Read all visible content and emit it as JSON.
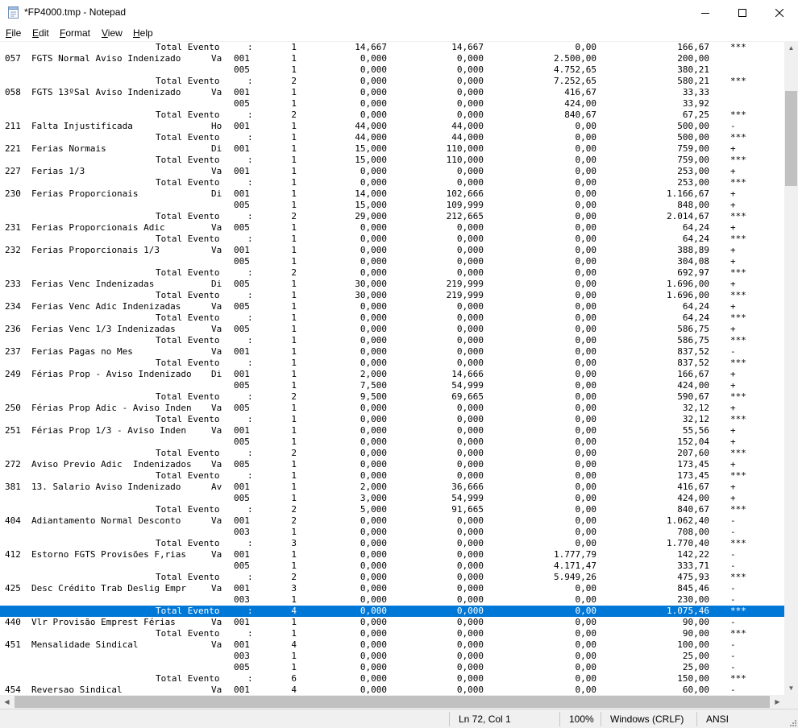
{
  "window": {
    "title": "*FP4000.tmp - Notepad"
  },
  "menu": [
    {
      "label": "File",
      "key": "F",
      "rest": "ile"
    },
    {
      "label": "Edit",
      "key": "E",
      "rest": "dit"
    },
    {
      "label": "Format",
      "key": "F",
      "rest": "ormat"
    },
    {
      "label": "View",
      "key": "V",
      "rest": "iew"
    },
    {
      "label": "Help",
      "key": "H",
      "rest": "elp"
    }
  ],
  "editor": {
    "lines": [
      {
        "code": "",
        "desc": "",
        "tipo": "",
        "ref": "",
        "qt": "1",
        "v1": "14,667",
        "v2": "14,667",
        "v3": "0,00",
        "v4": "166,67",
        "flag": "***",
        "tot": true
      },
      {
        "code": "057",
        "desc": "FGTS Normal Aviso Indenizado",
        "tipo": "Va",
        "ref": "001",
        "qt": "1",
        "v1": "0,000",
        "v2": "0,000",
        "v3": "2.500,00",
        "v4": "200,00",
        "flag": ""
      },
      {
        "code": "",
        "desc": "",
        "tipo": "",
        "ref": "005",
        "qt": "1",
        "v1": "0,000",
        "v2": "0,000",
        "v3": "4.752,65",
        "v4": "380,21",
        "flag": ""
      },
      {
        "code": "",
        "desc": "",
        "tipo": "",
        "ref": "",
        "qt": "2",
        "v1": "0,000",
        "v2": "0,000",
        "v3": "7.252,65",
        "v4": "580,21",
        "flag": "***",
        "tot": true
      },
      {
        "code": "058",
        "desc": "FGTS 13ºSal Aviso Indenizado",
        "tipo": "Va",
        "ref": "001",
        "qt": "1",
        "v1": "0,000",
        "v2": "0,000",
        "v3": "416,67",
        "v4": "33,33",
        "flag": ""
      },
      {
        "code": "",
        "desc": "",
        "tipo": "",
        "ref": "005",
        "qt": "1",
        "v1": "0,000",
        "v2": "0,000",
        "v3": "424,00",
        "v4": "33,92",
        "flag": ""
      },
      {
        "code": "",
        "desc": "",
        "tipo": "",
        "ref": "",
        "qt": "2",
        "v1": "0,000",
        "v2": "0,000",
        "v3": "840,67",
        "v4": "67,25",
        "flag": "***",
        "tot": true
      },
      {
        "code": "211",
        "desc": "Falta Injustificada",
        "tipo": "Ho",
        "ref": "001",
        "qt": "1",
        "v1": "44,000",
        "v2": "44,000",
        "v3": "0,00",
        "v4": "500,00",
        "flag": "-"
      },
      {
        "code": "",
        "desc": "",
        "tipo": "",
        "ref": "",
        "qt": "1",
        "v1": "44,000",
        "v2": "44,000",
        "v3": "0,00",
        "v4": "500,00",
        "flag": "***",
        "tot": true
      },
      {
        "code": "221",
        "desc": "Ferias Normais",
        "tipo": "Di",
        "ref": "001",
        "qt": "1",
        "v1": "15,000",
        "v2": "110,000",
        "v3": "0,00",
        "v4": "759,00",
        "flag": "+"
      },
      {
        "code": "",
        "desc": "",
        "tipo": "",
        "ref": "",
        "qt": "1",
        "v1": "15,000",
        "v2": "110,000",
        "v3": "0,00",
        "v4": "759,00",
        "flag": "***",
        "tot": true
      },
      {
        "code": "227",
        "desc": "Ferias 1/3",
        "tipo": "Va",
        "ref": "001",
        "qt": "1",
        "v1": "0,000",
        "v2": "0,000",
        "v3": "0,00",
        "v4": "253,00",
        "flag": "+"
      },
      {
        "code": "",
        "desc": "",
        "tipo": "",
        "ref": "",
        "qt": "1",
        "v1": "0,000",
        "v2": "0,000",
        "v3": "0,00",
        "v4": "253,00",
        "flag": "***",
        "tot": true
      },
      {
        "code": "230",
        "desc": "Ferias Proporcionais",
        "tipo": "Di",
        "ref": "001",
        "qt": "1",
        "v1": "14,000",
        "v2": "102,666",
        "v3": "0,00",
        "v4": "1.166,67",
        "flag": "+"
      },
      {
        "code": "",
        "desc": "",
        "tipo": "",
        "ref": "005",
        "qt": "1",
        "v1": "15,000",
        "v2": "109,999",
        "v3": "0,00",
        "v4": "848,00",
        "flag": "+"
      },
      {
        "code": "",
        "desc": "",
        "tipo": "",
        "ref": "",
        "qt": "2",
        "v1": "29,000",
        "v2": "212,665",
        "v3": "0,00",
        "v4": "2.014,67",
        "flag": "***",
        "tot": true
      },
      {
        "code": "231",
        "desc": "Ferias Proporcionais Adic",
        "tipo": "Va",
        "ref": "005",
        "qt": "1",
        "v1": "0,000",
        "v2": "0,000",
        "v3": "0,00",
        "v4": "64,24",
        "flag": "+"
      },
      {
        "code": "",
        "desc": "",
        "tipo": "",
        "ref": "",
        "qt": "1",
        "v1": "0,000",
        "v2": "0,000",
        "v3": "0,00",
        "v4": "64,24",
        "flag": "***",
        "tot": true
      },
      {
        "code": "232",
        "desc": "Ferias Proporcionais 1/3",
        "tipo": "Va",
        "ref": "001",
        "qt": "1",
        "v1": "0,000",
        "v2": "0,000",
        "v3": "0,00",
        "v4": "388,89",
        "flag": "+"
      },
      {
        "code": "",
        "desc": "",
        "tipo": "",
        "ref": "005",
        "qt": "1",
        "v1": "0,000",
        "v2": "0,000",
        "v3": "0,00",
        "v4": "304,08",
        "flag": "+"
      },
      {
        "code": "",
        "desc": "",
        "tipo": "",
        "ref": "",
        "qt": "2",
        "v1": "0,000",
        "v2": "0,000",
        "v3": "0,00",
        "v4": "692,97",
        "flag": "***",
        "tot": true
      },
      {
        "code": "233",
        "desc": "Ferias Venc Indenizadas",
        "tipo": "Di",
        "ref": "005",
        "qt": "1",
        "v1": "30,000",
        "v2": "219,999",
        "v3": "0,00",
        "v4": "1.696,00",
        "flag": "+"
      },
      {
        "code": "",
        "desc": "",
        "tipo": "",
        "ref": "",
        "qt": "1",
        "v1": "30,000",
        "v2": "219,999",
        "v3": "0,00",
        "v4": "1.696,00",
        "flag": "***",
        "tot": true
      },
      {
        "code": "234",
        "desc": "Ferias Venc Adic Indenizadas",
        "tipo": "Va",
        "ref": "005",
        "qt": "1",
        "v1": "0,000",
        "v2": "0,000",
        "v3": "0,00",
        "v4": "64,24",
        "flag": "+"
      },
      {
        "code": "",
        "desc": "",
        "tipo": "",
        "ref": "",
        "qt": "1",
        "v1": "0,000",
        "v2": "0,000",
        "v3": "0,00",
        "v4": "64,24",
        "flag": "***",
        "tot": true
      },
      {
        "code": "236",
        "desc": "Ferias Venc 1/3 Indenizadas",
        "tipo": "Va",
        "ref": "005",
        "qt": "1",
        "v1": "0,000",
        "v2": "0,000",
        "v3": "0,00",
        "v4": "586,75",
        "flag": "+"
      },
      {
        "code": "",
        "desc": "",
        "tipo": "",
        "ref": "",
        "qt": "1",
        "v1": "0,000",
        "v2": "0,000",
        "v3": "0,00",
        "v4": "586,75",
        "flag": "***",
        "tot": true
      },
      {
        "code": "237",
        "desc": "Ferias Pagas no Mes",
        "tipo": "Va",
        "ref": "001",
        "qt": "1",
        "v1": "0,000",
        "v2": "0,000",
        "v3": "0,00",
        "v4": "837,52",
        "flag": "-"
      },
      {
        "code": "",
        "desc": "",
        "tipo": "",
        "ref": "",
        "qt": "1",
        "v1": "0,000",
        "v2": "0,000",
        "v3": "0,00",
        "v4": "837,52",
        "flag": "***",
        "tot": true
      },
      {
        "code": "249",
        "desc": "Férias Prop - Aviso Indenizado",
        "tipo": "Di",
        "ref": "001",
        "qt": "1",
        "v1": "2,000",
        "v2": "14,666",
        "v3": "0,00",
        "v4": "166,67",
        "flag": "+"
      },
      {
        "code": "",
        "desc": "",
        "tipo": "",
        "ref": "005",
        "qt": "1",
        "v1": "7,500",
        "v2": "54,999",
        "v3": "0,00",
        "v4": "424,00",
        "flag": "+"
      },
      {
        "code": "",
        "desc": "",
        "tipo": "",
        "ref": "",
        "qt": "2",
        "v1": "9,500",
        "v2": "69,665",
        "v3": "0,00",
        "v4": "590,67",
        "flag": "***",
        "tot": true
      },
      {
        "code": "250",
        "desc": "Férias Prop Adic - Aviso Inden",
        "tipo": "Va",
        "ref": "005",
        "qt": "1",
        "v1": "0,000",
        "v2": "0,000",
        "v3": "0,00",
        "v4": "32,12",
        "flag": "+"
      },
      {
        "code": "",
        "desc": "",
        "tipo": "",
        "ref": "",
        "qt": "1",
        "v1": "0,000",
        "v2": "0,000",
        "v3": "0,00",
        "v4": "32,12",
        "flag": "***",
        "tot": true
      },
      {
        "code": "251",
        "desc": "Férias Prop 1/3 - Aviso Inden",
        "tipo": "Va",
        "ref": "001",
        "qt": "1",
        "v1": "0,000",
        "v2": "0,000",
        "v3": "0,00",
        "v4": "55,56",
        "flag": "+"
      },
      {
        "code": "",
        "desc": "",
        "tipo": "",
        "ref": "005",
        "qt": "1",
        "v1": "0,000",
        "v2": "0,000",
        "v3": "0,00",
        "v4": "152,04",
        "flag": "+"
      },
      {
        "code": "",
        "desc": "",
        "tipo": "",
        "ref": "",
        "qt": "2",
        "v1": "0,000",
        "v2": "0,000",
        "v3": "0,00",
        "v4": "207,60",
        "flag": "***",
        "tot": true
      },
      {
        "code": "272",
        "desc": "Aviso Previo Adic  Indenizados",
        "tipo": "Va",
        "ref": "005",
        "qt": "1",
        "v1": "0,000",
        "v2": "0,000",
        "v3": "0,00",
        "v4": "173,45",
        "flag": "+"
      },
      {
        "code": "",
        "desc": "",
        "tipo": "",
        "ref": "",
        "qt": "1",
        "v1": "0,000",
        "v2": "0,000",
        "v3": "0,00",
        "v4": "173,45",
        "flag": "***",
        "tot": true
      },
      {
        "code": "381",
        "desc": "13. Salario Aviso Indenizado",
        "tipo": "Av",
        "ref": "001",
        "qt": "1",
        "v1": "2,000",
        "v2": "36,666",
        "v3": "0,00",
        "v4": "416,67",
        "flag": "+"
      },
      {
        "code": "",
        "desc": "",
        "tipo": "",
        "ref": "005",
        "qt": "1",
        "v1": "3,000",
        "v2": "54,999",
        "v3": "0,00",
        "v4": "424,00",
        "flag": "+"
      },
      {
        "code": "",
        "desc": "",
        "tipo": "",
        "ref": "",
        "qt": "2",
        "v1": "5,000",
        "v2": "91,665",
        "v3": "0,00",
        "v4": "840,67",
        "flag": "***",
        "tot": true
      },
      {
        "code": "404",
        "desc": "Adiantamento Normal Desconto",
        "tipo": "Va",
        "ref": "001",
        "qt": "2",
        "v1": "0,000",
        "v2": "0,000",
        "v3": "0,00",
        "v4": "1.062,40",
        "flag": "-"
      },
      {
        "code": "",
        "desc": "",
        "tipo": "",
        "ref": "003",
        "qt": "1",
        "v1": "0,000",
        "v2": "0,000",
        "v3": "0,00",
        "v4": "708,00",
        "flag": "-"
      },
      {
        "code": "",
        "desc": "",
        "tipo": "",
        "ref": "",
        "qt": "3",
        "v1": "0,000",
        "v2": "0,000",
        "v3": "0,00",
        "v4": "1.770,40",
        "flag": "***",
        "tot": true
      },
      {
        "code": "412",
        "desc": "Estorno FGTS Provisões F,rias",
        "tipo": "Va",
        "ref": "001",
        "qt": "1",
        "v1": "0,000",
        "v2": "0,000",
        "v3": "1.777,79",
        "v4": "142,22",
        "flag": "-"
      },
      {
        "code": "",
        "desc": "",
        "tipo": "",
        "ref": "005",
        "qt": "1",
        "v1": "0,000",
        "v2": "0,000",
        "v3": "4.171,47",
        "v4": "333,71",
        "flag": "-"
      },
      {
        "code": "",
        "desc": "",
        "tipo": "",
        "ref": "",
        "qt": "2",
        "v1": "0,000",
        "v2": "0,000",
        "v3": "5.949,26",
        "v4": "475,93",
        "flag": "***",
        "tot": true
      },
      {
        "code": "425",
        "desc": "Desc Crédito Trab Deslig Empr",
        "tipo": "Va",
        "ref": "001",
        "qt": "3",
        "v1": "0,000",
        "v2": "0,000",
        "v3": "0,00",
        "v4": "845,46",
        "flag": "-"
      },
      {
        "code": "",
        "desc": "",
        "tipo": "",
        "ref": "003",
        "qt": "1",
        "v1": "0,000",
        "v2": "0,000",
        "v3": "0,00",
        "v4": "230,00",
        "flag": "-"
      },
      {
        "code": "",
        "desc": "",
        "tipo": "",
        "ref": "",
        "qt": "4",
        "v1": "0,000",
        "v2": "0,000",
        "v3": "0,00",
        "v4": "1.075,46",
        "flag": "***",
        "tot": true,
        "selected": true
      },
      {
        "code": "440",
        "desc": "Vlr Provisão Emprest Férias",
        "tipo": "Va",
        "ref": "001",
        "qt": "1",
        "v1": "0,000",
        "v2": "0,000",
        "v3": "0,00",
        "v4": "90,00",
        "flag": "-"
      },
      {
        "code": "",
        "desc": "",
        "tipo": "",
        "ref": "",
        "qt": "1",
        "v1": "0,000",
        "v2": "0,000",
        "v3": "0,00",
        "v4": "90,00",
        "flag": "***",
        "tot": true
      },
      {
        "code": "451",
        "desc": "Mensalidade Sindical",
        "tipo": "Va",
        "ref": "001",
        "qt": "4",
        "v1": "0,000",
        "v2": "0,000",
        "v3": "0,00",
        "v4": "100,00",
        "flag": "-"
      },
      {
        "code": "",
        "desc": "",
        "tipo": "",
        "ref": "003",
        "qt": "1",
        "v1": "0,000",
        "v2": "0,000",
        "v3": "0,00",
        "v4": "25,00",
        "flag": "-"
      },
      {
        "code": "",
        "desc": "",
        "tipo": "",
        "ref": "005",
        "qt": "1",
        "v1": "0,000",
        "v2": "0,000",
        "v3": "0,00",
        "v4": "25,00",
        "flag": "-"
      },
      {
        "code": "",
        "desc": "",
        "tipo": "",
        "ref": "",
        "qt": "6",
        "v1": "0,000",
        "v2": "0,000",
        "v3": "0,00",
        "v4": "150,00",
        "flag": "***",
        "tot": true
      },
      {
        "code": "454",
        "desc": "Reversao Sindical",
        "tipo": "Va",
        "ref": "001",
        "qt": "4",
        "v1": "0,000",
        "v2": "0,000",
        "v3": "0,00",
        "v4": "60,00",
        "flag": "-"
      }
    ],
    "total_label": "Total Evento",
    "total_sep": ":",
    "selection_color": "#0078d7"
  },
  "statusbar": {
    "position": "Ln 72, Col 1",
    "zoom": "100%",
    "line_ending": "Windows (CRLF)",
    "encoding": "ANSI"
  }
}
